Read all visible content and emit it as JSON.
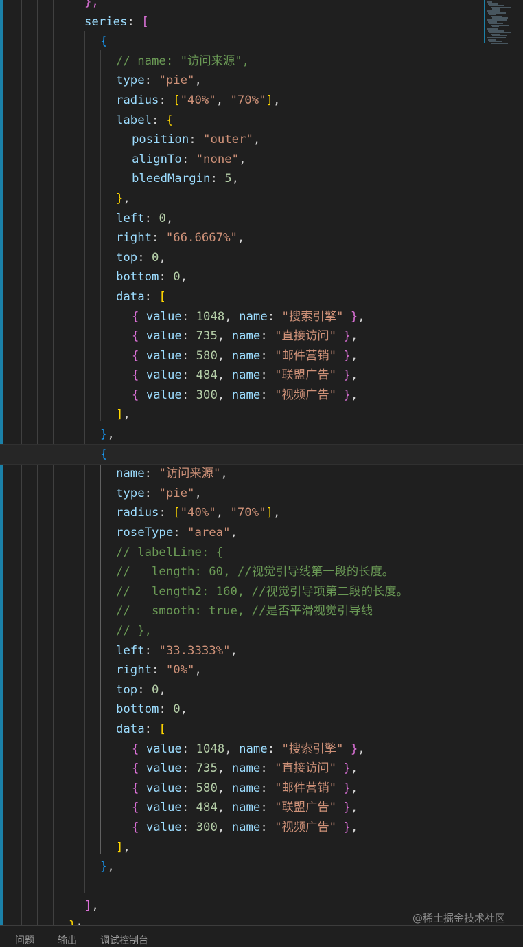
{
  "editor": {
    "current_line": 23,
    "lines": [
      {
        "i": 5,
        "t": [
          [
            "},",
            "b1"
          ]
        ]
      },
      {
        "i": 5,
        "t": [
          [
            "series",
            "k"
          ],
          [
            ": ",
            "p"
          ],
          [
            "[",
            "b1"
          ]
        ]
      },
      {
        "i": 6,
        "t": [
          [
            "{",
            "b2"
          ]
        ]
      },
      {
        "i": 7,
        "t": [
          [
            "// name: \"访问来源\",",
            "c"
          ]
        ]
      },
      {
        "i": 7,
        "t": [
          [
            "type",
            "k"
          ],
          [
            ": ",
            "p"
          ],
          [
            "\"pie\"",
            "s"
          ],
          [
            ",",
            "p"
          ]
        ]
      },
      {
        "i": 7,
        "t": [
          [
            "radius",
            "k"
          ],
          [
            ": ",
            "p"
          ],
          [
            "[",
            "b3"
          ],
          [
            "\"40%\"",
            "s"
          ],
          [
            ", ",
            "p"
          ],
          [
            "\"70%\"",
            "s"
          ],
          [
            "]",
            "b3"
          ],
          [
            ",",
            "p"
          ]
        ]
      },
      {
        "i": 7,
        "t": [
          [
            "label",
            "k"
          ],
          [
            ": ",
            "p"
          ],
          [
            "{",
            "b3"
          ]
        ]
      },
      {
        "i": 8,
        "t": [
          [
            "position",
            "k"
          ],
          [
            ": ",
            "p"
          ],
          [
            "\"outer\"",
            "s"
          ],
          [
            ",",
            "p"
          ]
        ]
      },
      {
        "i": 8,
        "t": [
          [
            "alignTo",
            "k"
          ],
          [
            ": ",
            "p"
          ],
          [
            "\"none\"",
            "s"
          ],
          [
            ",",
            "p"
          ]
        ]
      },
      {
        "i": 8,
        "t": [
          [
            "bleedMargin",
            "k"
          ],
          [
            ": ",
            "p"
          ],
          [
            "5",
            "n"
          ],
          [
            ",",
            "p"
          ]
        ]
      },
      {
        "i": 7,
        "t": [
          [
            "}",
            "b3"
          ],
          [
            ",",
            "p"
          ]
        ]
      },
      {
        "i": 7,
        "t": [
          [
            "left",
            "k"
          ],
          [
            ": ",
            "p"
          ],
          [
            "0",
            "n"
          ],
          [
            ",",
            "p"
          ]
        ]
      },
      {
        "i": 7,
        "t": [
          [
            "right",
            "k"
          ],
          [
            ": ",
            "p"
          ],
          [
            "\"66.6667%\"",
            "s"
          ],
          [
            ",",
            "p"
          ]
        ]
      },
      {
        "i": 7,
        "t": [
          [
            "top",
            "k"
          ],
          [
            ": ",
            "p"
          ],
          [
            "0",
            "n"
          ],
          [
            ",",
            "p"
          ]
        ]
      },
      {
        "i": 7,
        "t": [
          [
            "bottom",
            "k"
          ],
          [
            ": ",
            "p"
          ],
          [
            "0",
            "n"
          ],
          [
            ",",
            "p"
          ]
        ]
      },
      {
        "i": 7,
        "t": [
          [
            "data",
            "k"
          ],
          [
            ": ",
            "p"
          ],
          [
            "[",
            "b3"
          ]
        ]
      },
      {
        "i": 8,
        "t": [
          [
            "{ ",
            "b1"
          ],
          [
            "value",
            "k"
          ],
          [
            ": ",
            "p"
          ],
          [
            "1048",
            "n"
          ],
          [
            ", ",
            "p"
          ],
          [
            "name",
            "k"
          ],
          [
            ": ",
            "p"
          ],
          [
            "\"搜索引擎\"",
            "s"
          ],
          [
            " }",
            "b1"
          ],
          [
            ",",
            "p"
          ]
        ]
      },
      {
        "i": 8,
        "t": [
          [
            "{ ",
            "b1"
          ],
          [
            "value",
            "k"
          ],
          [
            ": ",
            "p"
          ],
          [
            "735",
            "n"
          ],
          [
            ", ",
            "p"
          ],
          [
            "name",
            "k"
          ],
          [
            ": ",
            "p"
          ],
          [
            "\"直接访问\"",
            "s"
          ],
          [
            " }",
            "b1"
          ],
          [
            ",",
            "p"
          ]
        ]
      },
      {
        "i": 8,
        "t": [
          [
            "{ ",
            "b1"
          ],
          [
            "value",
            "k"
          ],
          [
            ": ",
            "p"
          ],
          [
            "580",
            "n"
          ],
          [
            ", ",
            "p"
          ],
          [
            "name",
            "k"
          ],
          [
            ": ",
            "p"
          ],
          [
            "\"邮件营销\"",
            "s"
          ],
          [
            " }",
            "b1"
          ],
          [
            ",",
            "p"
          ]
        ]
      },
      {
        "i": 8,
        "t": [
          [
            "{ ",
            "b1"
          ],
          [
            "value",
            "k"
          ],
          [
            ": ",
            "p"
          ],
          [
            "484",
            "n"
          ],
          [
            ", ",
            "p"
          ],
          [
            "name",
            "k"
          ],
          [
            ": ",
            "p"
          ],
          [
            "\"联盟广告\"",
            "s"
          ],
          [
            " }",
            "b1"
          ],
          [
            ",",
            "p"
          ]
        ]
      },
      {
        "i": 8,
        "t": [
          [
            "{ ",
            "b1"
          ],
          [
            "value",
            "k"
          ],
          [
            ": ",
            "p"
          ],
          [
            "300",
            "n"
          ],
          [
            ", ",
            "p"
          ],
          [
            "name",
            "k"
          ],
          [
            ": ",
            "p"
          ],
          [
            "\"视频广告\"",
            "s"
          ],
          [
            " }",
            "b1"
          ],
          [
            ",",
            "p"
          ]
        ]
      },
      {
        "i": 7,
        "t": [
          [
            "]",
            "b3"
          ],
          [
            ",",
            "p"
          ]
        ]
      },
      {
        "i": 6,
        "t": [
          [
            "}",
            "b2"
          ],
          [
            ",",
            "p"
          ]
        ]
      },
      {
        "i": 6,
        "t": [
          [
            "{",
            "b2"
          ]
        ]
      },
      {
        "i": 7,
        "t": [
          [
            "name",
            "k"
          ],
          [
            ": ",
            "p"
          ],
          [
            "\"访问来源\"",
            "s"
          ],
          [
            ",",
            "p"
          ]
        ]
      },
      {
        "i": 7,
        "t": [
          [
            "type",
            "k"
          ],
          [
            ": ",
            "p"
          ],
          [
            "\"pie\"",
            "s"
          ],
          [
            ",",
            "p"
          ]
        ]
      },
      {
        "i": 7,
        "t": [
          [
            "radius",
            "k"
          ],
          [
            ": ",
            "p"
          ],
          [
            "[",
            "b3"
          ],
          [
            "\"40%\"",
            "s"
          ],
          [
            ", ",
            "p"
          ],
          [
            "\"70%\"",
            "s"
          ],
          [
            "]",
            "b3"
          ],
          [
            ",",
            "p"
          ]
        ]
      },
      {
        "i": 7,
        "t": [
          [
            "roseType",
            "k"
          ],
          [
            ": ",
            "p"
          ],
          [
            "\"area\"",
            "s"
          ],
          [
            ",",
            "p"
          ]
        ]
      },
      {
        "i": 7,
        "t": [
          [
            "// labelLine: {",
            "c"
          ]
        ]
      },
      {
        "i": 7,
        "t": [
          [
            "//   length: 60, //视觉引导线第一段的长度。",
            "c"
          ]
        ]
      },
      {
        "i": 7,
        "t": [
          [
            "//   length2: 160, //视觉引导项第二段的长度。",
            "c"
          ]
        ]
      },
      {
        "i": 7,
        "t": [
          [
            "//   smooth: true, //是否平滑视觉引导线",
            "c"
          ]
        ]
      },
      {
        "i": 7,
        "t": [
          [
            "// },",
            "c"
          ]
        ]
      },
      {
        "i": 7,
        "t": [
          [
            "left",
            "k"
          ],
          [
            ": ",
            "p"
          ],
          [
            "\"33.3333%\"",
            "s"
          ],
          [
            ",",
            "p"
          ]
        ]
      },
      {
        "i": 7,
        "t": [
          [
            "right",
            "k"
          ],
          [
            ": ",
            "p"
          ],
          [
            "\"0%\"",
            "s"
          ],
          [
            ",",
            "p"
          ]
        ]
      },
      {
        "i": 7,
        "t": [
          [
            "top",
            "k"
          ],
          [
            ": ",
            "p"
          ],
          [
            "0",
            "n"
          ],
          [
            ",",
            "p"
          ]
        ]
      },
      {
        "i": 7,
        "t": [
          [
            "bottom",
            "k"
          ],
          [
            ": ",
            "p"
          ],
          [
            "0",
            "n"
          ],
          [
            ",",
            "p"
          ]
        ]
      },
      {
        "i": 7,
        "t": [
          [
            "data",
            "k"
          ],
          [
            ": ",
            "p"
          ],
          [
            "[",
            "b3"
          ]
        ]
      },
      {
        "i": 8,
        "t": [
          [
            "{ ",
            "b1"
          ],
          [
            "value",
            "k"
          ],
          [
            ": ",
            "p"
          ],
          [
            "1048",
            "n"
          ],
          [
            ", ",
            "p"
          ],
          [
            "name",
            "k"
          ],
          [
            ": ",
            "p"
          ],
          [
            "\"搜索引擎\"",
            "s"
          ],
          [
            " }",
            "b1"
          ],
          [
            ",",
            "p"
          ]
        ]
      },
      {
        "i": 8,
        "t": [
          [
            "{ ",
            "b1"
          ],
          [
            "value",
            "k"
          ],
          [
            ": ",
            "p"
          ],
          [
            "735",
            "n"
          ],
          [
            ", ",
            "p"
          ],
          [
            "name",
            "k"
          ],
          [
            ": ",
            "p"
          ],
          [
            "\"直接访问\"",
            "s"
          ],
          [
            " }",
            "b1"
          ],
          [
            ",",
            "p"
          ]
        ]
      },
      {
        "i": 8,
        "t": [
          [
            "{ ",
            "b1"
          ],
          [
            "value",
            "k"
          ],
          [
            ": ",
            "p"
          ],
          [
            "580",
            "n"
          ],
          [
            ", ",
            "p"
          ],
          [
            "name",
            "k"
          ],
          [
            ": ",
            "p"
          ],
          [
            "\"邮件营销\"",
            "s"
          ],
          [
            " }",
            "b1"
          ],
          [
            ",",
            "p"
          ]
        ]
      },
      {
        "i": 8,
        "t": [
          [
            "{ ",
            "b1"
          ],
          [
            "value",
            "k"
          ],
          [
            ": ",
            "p"
          ],
          [
            "484",
            "n"
          ],
          [
            ", ",
            "p"
          ],
          [
            "name",
            "k"
          ],
          [
            ": ",
            "p"
          ],
          [
            "\"联盟广告\"",
            "s"
          ],
          [
            " }",
            "b1"
          ],
          [
            ",",
            "p"
          ]
        ]
      },
      {
        "i": 8,
        "t": [
          [
            "{ ",
            "b1"
          ],
          [
            "value",
            "k"
          ],
          [
            ": ",
            "p"
          ],
          [
            "300",
            "n"
          ],
          [
            ", ",
            "p"
          ],
          [
            "name",
            "k"
          ],
          [
            ": ",
            "p"
          ],
          [
            "\"视频广告\"",
            "s"
          ],
          [
            " }",
            "b1"
          ],
          [
            ",",
            "p"
          ]
        ]
      },
      {
        "i": 7,
        "t": [
          [
            "]",
            "b3"
          ],
          [
            ",",
            "p"
          ]
        ]
      },
      {
        "i": 6,
        "t": [
          [
            "}",
            "b2"
          ],
          [
            ",",
            "p"
          ]
        ]
      },
      {
        "i": 0,
        "t": []
      },
      {
        "i": 5,
        "t": [
          [
            "]",
            "b1"
          ],
          [
            ",",
            "p"
          ]
        ]
      },
      {
        "i": 4,
        "t": [
          [
            "}",
            "b3"
          ],
          [
            ";",
            "p"
          ]
        ]
      }
    ]
  },
  "panel": {
    "tabs": [
      "问题",
      "输出",
      "调试控制台"
    ]
  },
  "watermark": "@稀土掘金技术社区"
}
